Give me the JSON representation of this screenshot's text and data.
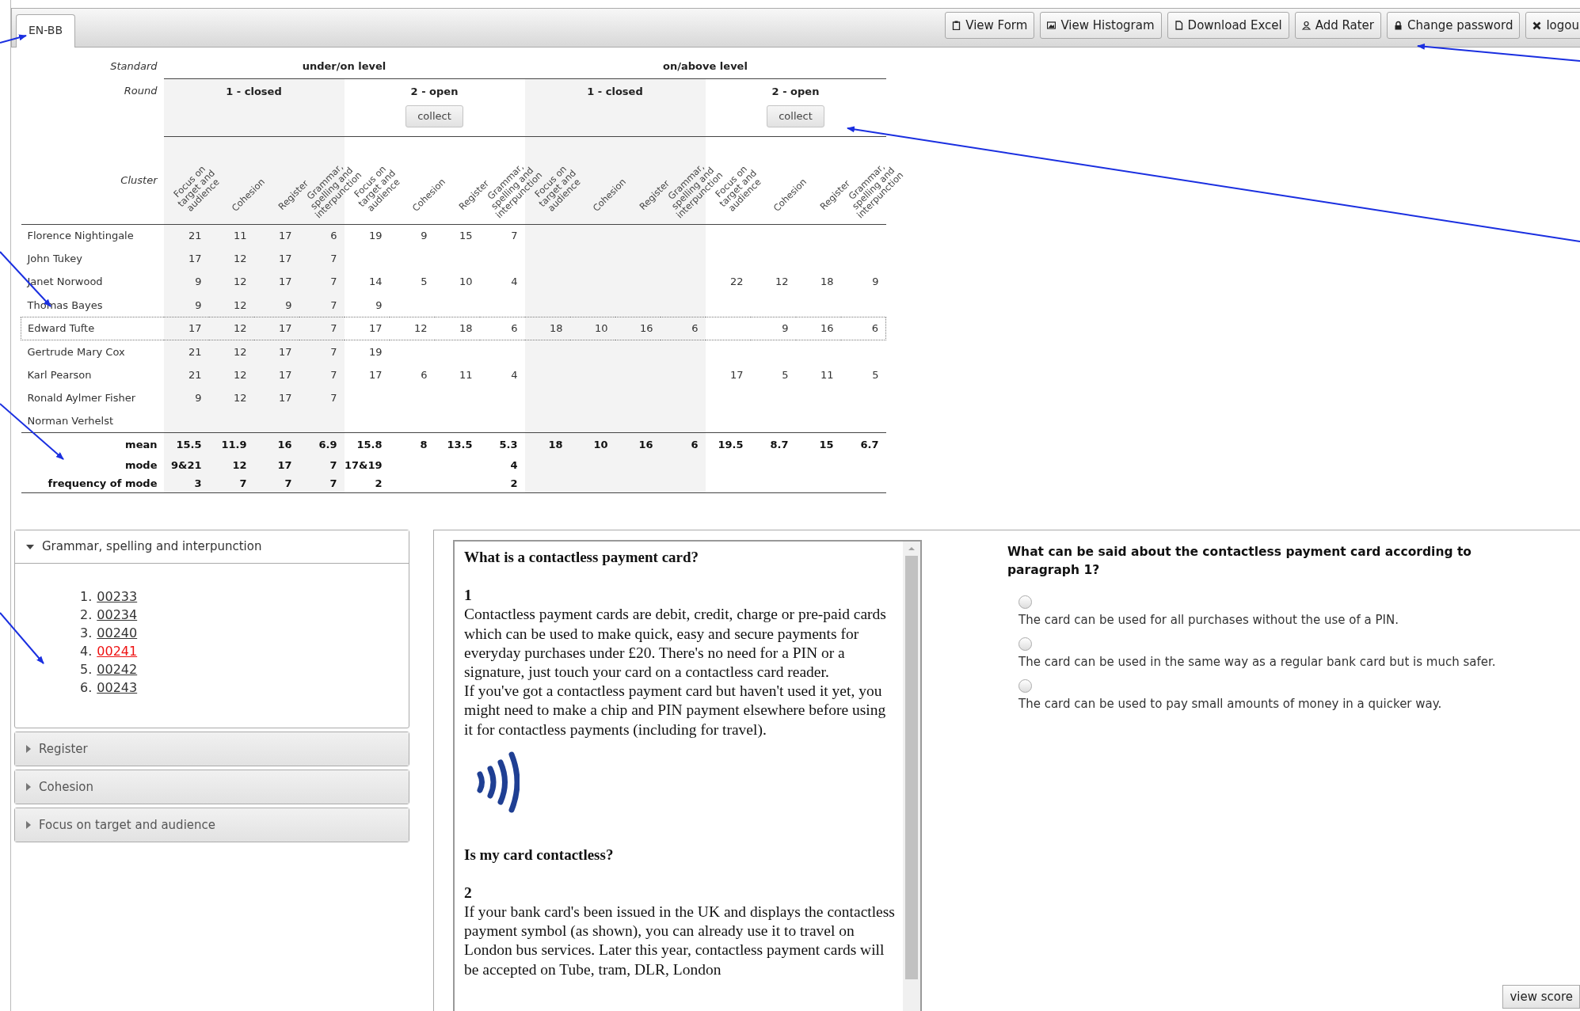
{
  "tabs": [
    {
      "label": "EN-BB",
      "selected": true
    }
  ],
  "toolbar": [
    {
      "label": "View Form",
      "kind": "form"
    },
    {
      "label": "View Histogram",
      "kind": "histogram"
    },
    {
      "label": "Download Excel",
      "kind": "download"
    },
    {
      "label": "Add Rater",
      "kind": "rater"
    },
    {
      "label": "Change password",
      "kind": "password"
    },
    {
      "label": "logou",
      "kind": "logout"
    }
  ],
  "table": {
    "row_labels": {
      "standard": "Standard",
      "round": "Round",
      "cluster": "Cluster"
    },
    "standards": [
      {
        "label": "under/on level",
        "rounds": [
          {
            "label": "1 - closed",
            "shaded": true
          },
          {
            "label": "2 - open",
            "shaded": false,
            "button": "collect"
          }
        ]
      },
      {
        "label": "on/above level",
        "rounds": [
          {
            "label": "1 - closed",
            "shaded": true
          },
          {
            "label": "2 - open",
            "shaded": false,
            "button": "collect"
          }
        ]
      }
    ],
    "clusters": [
      "Focus on target and audience",
      "Cohesion",
      "Register",
      "Grammar, spelling and interpunction",
      "Focus on target and audience",
      "Cohesion",
      "Register",
      "Grammar, spelling and interpunction",
      "Focus on target and audience",
      "Cohesion",
      "Register",
      "Grammar, spelling and interpunction",
      "Focus on target and audience",
      "Cohesion",
      "Register",
      "Grammar, spelling and interpunction"
    ],
    "rows": [
      {
        "name": "Florence Nightingale",
        "focused": false,
        "cells": [
          {
            "text": "21"
          },
          {
            "text": "11"
          },
          {
            "text": "17"
          },
          {
            "text": "6"
          },
          {
            "text": "19"
          },
          {
            "text": "9"
          },
          {
            "text": "15"
          },
          {
            "text": "7"
          },
          {
            "blank": true
          },
          {
            "blank": true
          },
          {
            "blank": true
          },
          {
            "blank": true
          },
          {
            "blank": true
          },
          {
            "blank": true
          },
          {
            "blank": true
          },
          {
            "blank": true
          }
        ]
      },
      {
        "name": "John Tukey",
        "focused": false,
        "cells": [
          {
            "text": "17"
          },
          {
            "text": "12"
          },
          {
            "text": "17"
          },
          {
            "text": "7"
          },
          {
            "blank": true
          },
          {
            "blank": true
          },
          {
            "blank": true
          },
          {
            "blank": true
          },
          {
            "blank": true
          },
          {
            "blank": true
          },
          {
            "blank": true
          },
          {
            "blank": true
          },
          {
            "blank": true
          },
          {
            "blank": true
          },
          {
            "blank": true
          },
          {
            "blank": true
          }
        ]
      },
      {
        "name": "Janet Norwood",
        "focused": false,
        "cells": [
          {
            "text": "9"
          },
          {
            "text": "12"
          },
          {
            "text": "17"
          },
          {
            "text": "7"
          },
          {
            "text": "14"
          },
          {
            "text": "5"
          },
          {
            "text": "10"
          },
          {
            "text": "4"
          },
          {
            "blank": true
          },
          {
            "blank": true
          },
          {
            "blank": true
          },
          {
            "blank": true
          },
          {
            "text": "22"
          },
          {
            "text": "12"
          },
          {
            "text": "18"
          },
          {
            "text": "9"
          }
        ]
      },
      {
        "name": "Thomas Bayes",
        "focused": false,
        "cells": [
          {
            "text": "9"
          },
          {
            "text": "12"
          },
          {
            "text": "9"
          },
          {
            "text": "7"
          },
          {
            "text": "9"
          },
          {
            "blank": true
          },
          {
            "blank": true
          },
          {
            "blank": true
          },
          {
            "blank": true
          },
          {
            "blank": true
          },
          {
            "blank": true
          },
          {
            "blank": true
          },
          {
            "blank": true
          },
          {
            "blank": true
          },
          {
            "blank": true
          },
          {
            "blank": true
          }
        ]
      },
      {
        "name": "Edward Tufte",
        "focused": true,
        "cells": [
          {
            "text": "17"
          },
          {
            "text": "12"
          },
          {
            "text": "17"
          },
          {
            "text": "7"
          },
          {
            "text": "17"
          },
          {
            "text": "12"
          },
          {
            "text": "18"
          },
          {
            "text": "6"
          },
          {
            "text": "18"
          },
          {
            "text": "10"
          },
          {
            "text": "16"
          },
          {
            "text": "6"
          },
          {
            "blank": true
          },
          {
            "text": "9"
          },
          {
            "text": "16"
          },
          {
            "text": "6"
          }
        ]
      },
      {
        "name": "Gertrude Mary Cox",
        "focused": false,
        "cells": [
          {
            "text": "21"
          },
          {
            "text": "12"
          },
          {
            "text": "17"
          },
          {
            "text": "7"
          },
          {
            "text": "19"
          },
          {
            "blank": true
          },
          {
            "blank": true
          },
          {
            "blank": true
          },
          {
            "blank": true
          },
          {
            "blank": true
          },
          {
            "blank": true
          },
          {
            "blank": true
          },
          {
            "blank": true
          },
          {
            "blank": true
          },
          {
            "blank": true
          },
          {
            "blank": true
          }
        ]
      },
      {
        "name": "Karl Pearson",
        "focused": false,
        "cells": [
          {
            "text": "21"
          },
          {
            "text": "12"
          },
          {
            "text": "17"
          },
          {
            "text": "7"
          },
          {
            "text": "17"
          },
          {
            "text": "6"
          },
          {
            "text": "11"
          },
          {
            "text": "4"
          },
          {
            "blank": true
          },
          {
            "blank": true
          },
          {
            "blank": true
          },
          {
            "blank": true
          },
          {
            "text": "17"
          },
          {
            "text": "5"
          },
          {
            "text": "11"
          },
          {
            "text": "5"
          }
        ]
      },
      {
        "name": "Ronald Aylmer Fisher",
        "focused": false,
        "cells": [
          {
            "text": "9"
          },
          {
            "text": "12"
          },
          {
            "text": "17"
          },
          {
            "text": "7"
          },
          {
            "blank": true
          },
          {
            "blank": true
          },
          {
            "blank": true
          },
          {
            "blank": true
          },
          {
            "blank": true
          },
          {
            "blank": true
          },
          {
            "blank": true
          },
          {
            "blank": true
          },
          {
            "blank": true
          },
          {
            "blank": true
          },
          {
            "blank": true
          },
          {
            "blank": true
          }
        ]
      },
      {
        "name": "Norman Verhelst",
        "focused": false,
        "cells": [
          {
            "blank": true
          },
          {
            "blank": true
          },
          {
            "blank": true
          },
          {
            "blank": true
          },
          {
            "blank": true
          },
          {
            "blank": true
          },
          {
            "blank": true
          },
          {
            "blank": true
          },
          {
            "blank": true
          },
          {
            "blank": true
          },
          {
            "blank": true
          },
          {
            "blank": true
          },
          {
            "blank": true
          },
          {
            "blank": true
          },
          {
            "blank": true
          },
          {
            "blank": true
          }
        ]
      }
    ],
    "summary": [
      {
        "label": "mean",
        "cells": [
          {
            "text": "15.5"
          },
          {
            "text": "11.9"
          },
          {
            "text": "16"
          },
          {
            "text": "6.9"
          },
          {
            "text": "15.8"
          },
          {
            "text": "8"
          },
          {
            "text": "13.5"
          },
          {
            "text": "5.3"
          },
          {
            "text": "18"
          },
          {
            "text": "10"
          },
          {
            "text": "16"
          },
          {
            "text": "6"
          },
          {
            "text": "19.5"
          },
          {
            "text": "8.7"
          },
          {
            "text": "15"
          },
          {
            "text": "6.7"
          }
        ]
      },
      {
        "label": "mode",
        "cells": [
          {
            "text": "9&21"
          },
          {
            "text": "12"
          },
          {
            "text": "17"
          },
          {
            "text": "7"
          },
          {
            "text": "17&19"
          },
          {
            "blank": true
          },
          {
            "blank": true
          },
          {
            "text": "4"
          },
          {
            "blank": true
          },
          {
            "blank": true
          },
          {
            "blank": true
          },
          {
            "blank": true
          },
          {
            "blank": true
          },
          {
            "blank": true
          },
          {
            "blank": true
          },
          {
            "blank": true
          }
        ]
      },
      {
        "label": "frequency of mode",
        "cells": [
          {
            "text": "3"
          },
          {
            "text": "7"
          },
          {
            "text": "7"
          },
          {
            "text": "7"
          },
          {
            "text": "2"
          },
          {
            "blank": true
          },
          {
            "blank": true
          },
          {
            "text": "2"
          },
          {
            "blank": true
          },
          {
            "blank": true
          },
          {
            "blank": true
          },
          {
            "blank": true
          },
          {
            "blank": true
          },
          {
            "blank": true
          },
          {
            "blank": true
          },
          {
            "blank": true
          }
        ]
      }
    ]
  },
  "sections": [
    {
      "title": "Grammar, spelling and interpunction",
      "expanded": true,
      "items": [
        {
          "number": "1.",
          "label": "00233",
          "selected": false
        },
        {
          "number": "2.",
          "label": "00234",
          "selected": false
        },
        {
          "number": "3.",
          "label": "00240",
          "selected": false
        },
        {
          "number": "4.",
          "label": "00241",
          "selected": true
        },
        {
          "number": "5.",
          "label": "00242",
          "selected": false
        },
        {
          "number": "6.",
          "label": "00243",
          "selected": false
        }
      ]
    },
    {
      "title": "Register",
      "expanded": false
    },
    {
      "title": "Cohesion",
      "expanded": false
    },
    {
      "title": "Focus on target and audience",
      "expanded": false
    }
  ],
  "passage": [
    {
      "kind": "heading",
      "text": "What is a contactless payment card?"
    },
    {
      "kind": "number",
      "text": "1"
    },
    {
      "kind": "paragraph",
      "text": "Contactless payment cards are debit, credit, charge or pre-paid cards which can be used to make quick, easy and secure payments for everyday purchases under £20. There's no need for a PIN or a signature, just touch your card on a contactless card reader."
    },
    {
      "kind": "paragraph",
      "text": "If you've got a contactless payment card but haven't used it yet, you might need to make a chip and PIN payment elsewhere before using it for contactless payments (including for travel)."
    },
    {
      "kind": "symbol"
    },
    {
      "kind": "heading",
      "text": "Is my card contactless?"
    },
    {
      "kind": "number",
      "text": "2"
    },
    {
      "kind": "paragraph",
      "text": "If your bank card's been issued in the UK and displays the contactless payment symbol (as shown), you can already use it to travel on London bus services. Later this year, contactless payment cards will be accepted on Tube, tram, DLR, London"
    }
  ],
  "question": {
    "text": "What can be said about the contactless payment card according to paragraph 1?",
    "options": [
      {
        "label": "The card can be used for all purchases without the use of a PIN.",
        "selected": false
      },
      {
        "label": "The card can be used in the same way as a regular bank card but is much safer.",
        "selected": false
      },
      {
        "label": "The card can be used to pay small amounts of money in a quicker way.",
        "selected": false
      }
    ],
    "button": "view score"
  }
}
